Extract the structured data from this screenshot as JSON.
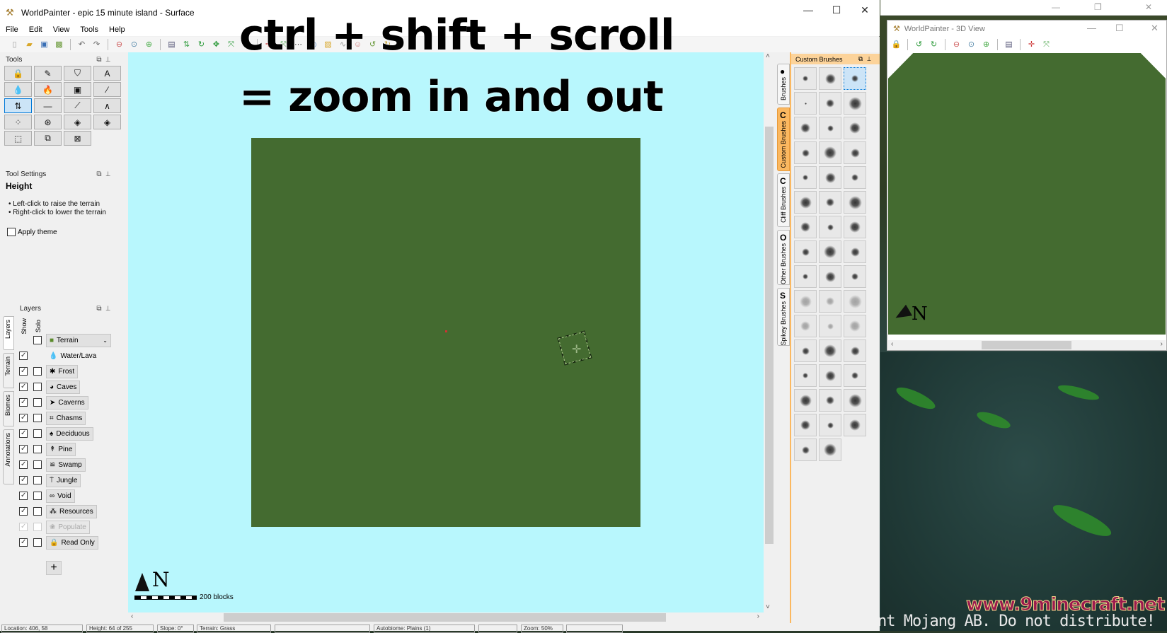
{
  "main_window": {
    "title": "WorldPainter - epic 15 minute island - Surface",
    "controls": {
      "minimize": "—",
      "maximize": "☐",
      "close": "✕"
    },
    "menu": [
      "File",
      "Edit",
      "View",
      "Tools",
      "Help"
    ],
    "toolbar_icons": [
      "new-icon",
      "open-icon",
      "save-icon",
      "export-icon",
      "undo-icon",
      "redo-icon",
      "zoom-out-icon",
      "zoom-reset-icon",
      "zoom-in-icon",
      "dimension-props-icon",
      "shift-height-icon",
      "rotate-icon",
      "move-icon",
      "expand-icon",
      "plugin-icon",
      "crosshair-icon",
      "fit-icon",
      "grid-icon",
      "view-surface-icon",
      "image-overlay-icon",
      "contour-icon",
      "user-icon",
      "rotate-left-icon",
      "rotate-right-icon"
    ]
  },
  "overlay": {
    "line1": "ctrl + shift + scroll",
    "line2": "= zoom in and out"
  },
  "tools_panel": {
    "title": "Tools",
    "tools": [
      {
        "name": "height-lock",
        "glyph": "🔒"
      },
      {
        "name": "pencil",
        "glyph": "✎"
      },
      {
        "name": "flood",
        "glyph": "⛉"
      },
      {
        "name": "text",
        "glyph": "A"
      },
      {
        "name": "water",
        "glyph": "💧"
      },
      {
        "name": "lava",
        "glyph": "🔥"
      },
      {
        "name": "sponge",
        "glyph": "▣"
      },
      {
        "name": "eyedropper",
        "glyph": "⁄"
      },
      {
        "name": "raise-lower",
        "glyph": "⇅",
        "selected": true
      },
      {
        "name": "flatten",
        "glyph": "—"
      },
      {
        "name": "smooth",
        "glyph": "⟋"
      },
      {
        "name": "mountain",
        "glyph": "∧"
      },
      {
        "name": "spray",
        "glyph": "⁘"
      },
      {
        "name": "raise-rotate",
        "glyph": "⊛"
      },
      {
        "name": "pyramid",
        "glyph": "◈"
      },
      {
        "name": "raise-pyramid",
        "glyph": "◈"
      },
      {
        "name": "select",
        "glyph": "⬚"
      },
      {
        "name": "copy-selection",
        "glyph": "⧉"
      },
      {
        "name": "clear-selection",
        "glyph": "⊠"
      }
    ]
  },
  "tool_settings": {
    "title": "Tool Settings",
    "heading": "Height",
    "lines": [
      "• Left-click to raise the terrain",
      "• Right-click to lower the terrain"
    ],
    "apply_theme_label": "Apply theme",
    "apply_theme_checked": false
  },
  "layers_panel": {
    "title": "Layers",
    "col_show": "Show",
    "col_solo": "Solo",
    "side_tabs": [
      "Layers",
      "Terrain",
      "Biomes",
      "Annotations"
    ],
    "terrain_select": "Terrain",
    "water_lava_label": "Water/Lava",
    "layers": [
      {
        "label": "Frost",
        "icon": "✱",
        "show": true,
        "solo": false
      },
      {
        "label": "Caves",
        "icon": "◕",
        "show": true,
        "solo": false
      },
      {
        "label": "Caverns",
        "icon": "➤",
        "show": true,
        "solo": false
      },
      {
        "label": "Chasms",
        "icon": "⌗",
        "show": true,
        "solo": false
      },
      {
        "label": "Deciduous",
        "icon": "♠",
        "show": true,
        "solo": false
      },
      {
        "label": "Pine",
        "icon": "↟",
        "show": true,
        "solo": false
      },
      {
        "label": "Swamp",
        "icon": "≌",
        "show": true,
        "solo": false
      },
      {
        "label": "Jungle",
        "icon": "⍑",
        "show": true,
        "solo": false
      },
      {
        "label": "Void",
        "icon": "∞",
        "show": true,
        "solo": false
      },
      {
        "label": "Resources",
        "icon": "⁂",
        "show": true,
        "solo": false
      },
      {
        "label": "Populate",
        "icon": "❀",
        "show": true,
        "solo": false,
        "disabled": true
      },
      {
        "label": "Read Only",
        "icon": "🔒",
        "show": true,
        "solo": false
      }
    ],
    "add_button": "+"
  },
  "canvas": {
    "background": "#b8f7fd",
    "land_color": "#446b30",
    "compass_label": "N",
    "scale_label": "200 blocks"
  },
  "status_bar": {
    "fields": [
      "Location: 406, 58",
      "Height: 64 of 255",
      "Slope: 0°",
      "Terrain: Grass",
      "",
      "Autobiome: Plains (1)",
      "",
      "Zoom: 50%",
      ""
    ]
  },
  "brush_tabs": [
    {
      "letter": "●",
      "label": "Brushes",
      "active": false
    },
    {
      "letter": "C",
      "label": "Custom Brushes",
      "active": true
    },
    {
      "letter": "C",
      "label": "Cliff Brushes",
      "active": false
    },
    {
      "letter": "O",
      "label": "Other Brushes",
      "active": false
    },
    {
      "letter": "S",
      "label": "Spikey Brushes",
      "active": false
    }
  ],
  "brush_panel": {
    "title": "Custom Brushes",
    "brush_count": 47,
    "selected_index": 2
  },
  "view3d": {
    "title": "WorldPainter - 3D View",
    "controls": {
      "minimize": "—",
      "maximize": "☐",
      "close": "✕"
    },
    "toolbar_icons": [
      "lock-icon",
      "rotate-left-icon",
      "rotate-right-icon",
      "zoom-out-icon",
      "zoom-reset-icon",
      "zoom-in-icon",
      "layers-icon",
      "crosshair-icon",
      "fit-icon"
    ],
    "compass_label": "N"
  },
  "background_window": {
    "controls": {
      "minimize": "—",
      "maximize": "❐",
      "close": "✕"
    }
  },
  "game_overlay": {
    "watermark": "www.9minecraft.net",
    "disclaimer": "nt Mojang AB. Do not distribute!"
  }
}
